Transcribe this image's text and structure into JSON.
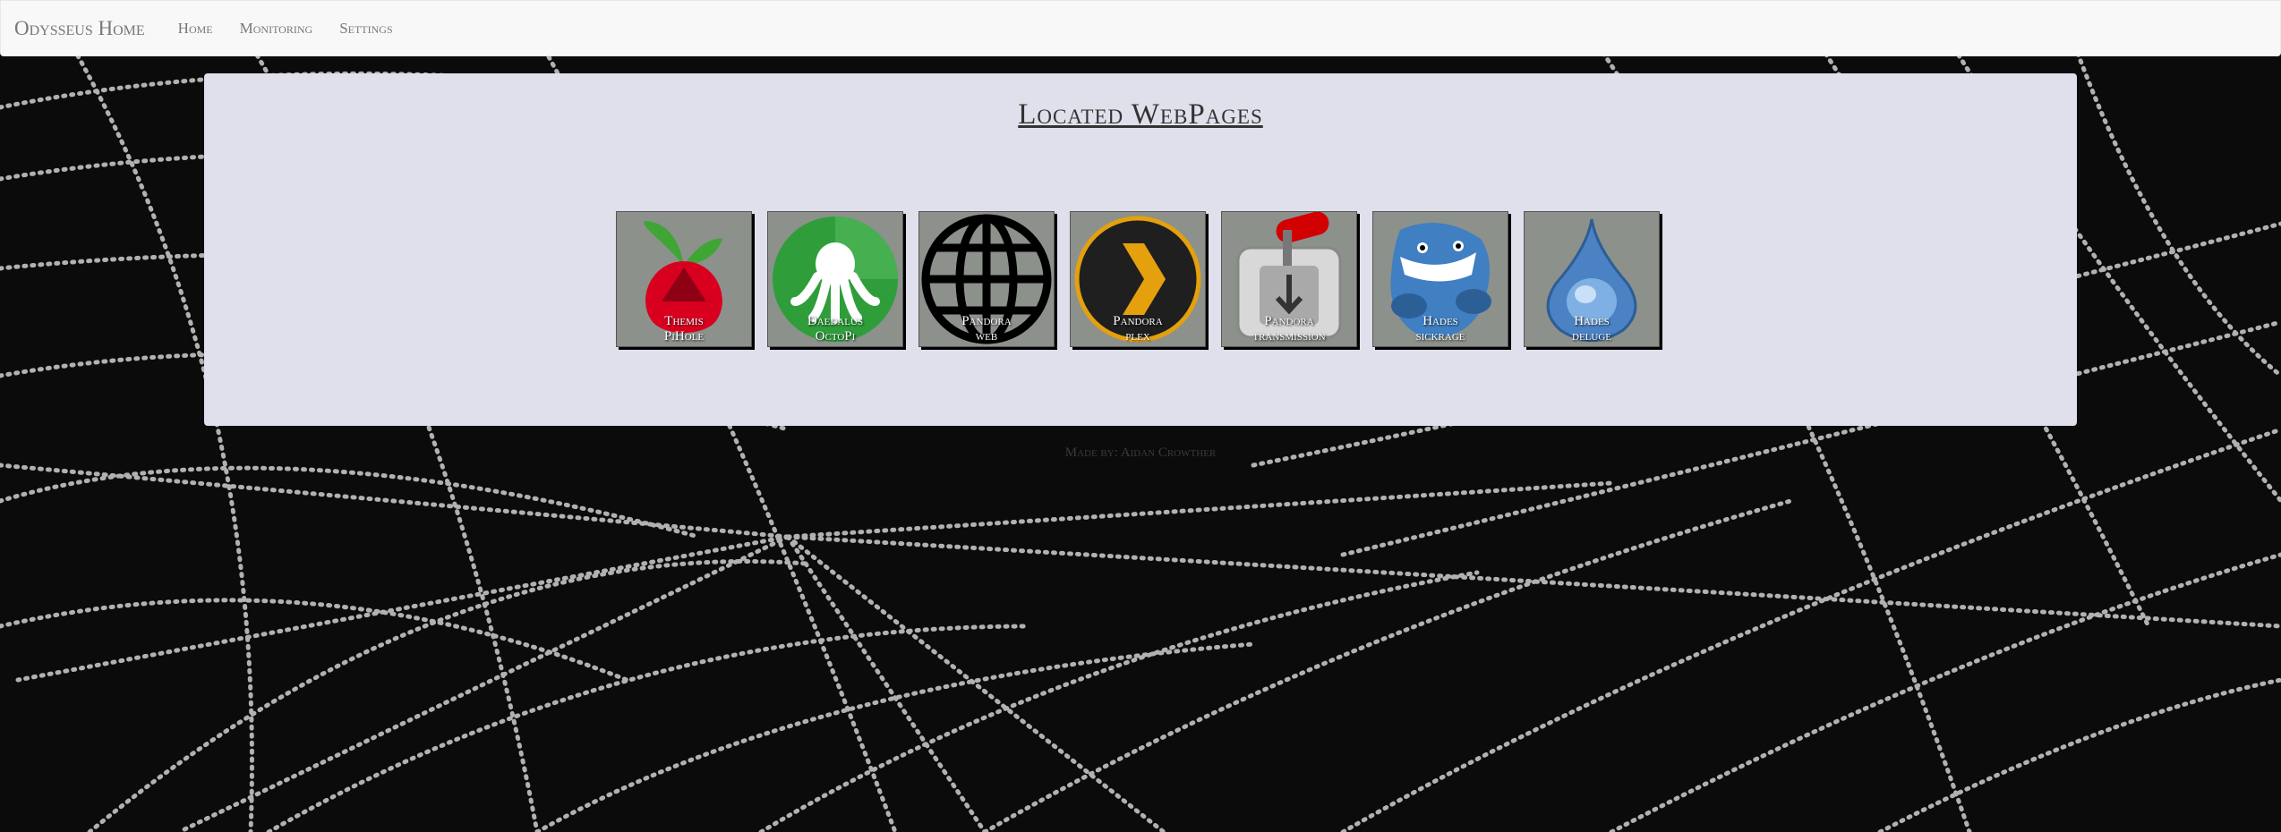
{
  "navbar": {
    "brand": "Odysseus Home",
    "links": [
      "Home",
      "Monitoring",
      "Settings"
    ]
  },
  "main": {
    "title": "Located WebPages",
    "tiles": [
      {
        "line1": "Themis",
        "line2": "PiHole",
        "icon": "pihole-icon"
      },
      {
        "line1": "Daedalus",
        "line2": "OctoPi",
        "icon": "octopi-icon"
      },
      {
        "line1": "Pandora",
        "line2": "web",
        "icon": "globe-icon"
      },
      {
        "line1": "Pandora",
        "line2": "plex",
        "icon": "plex-icon"
      },
      {
        "line1": "Pandora",
        "line2": "transmission",
        "icon": "transmission-icon"
      },
      {
        "line1": "Hades",
        "line2": "sickrage",
        "icon": "sickrage-icon"
      },
      {
        "line1": "Hades",
        "line2": "deluge",
        "icon": "deluge-icon"
      }
    ]
  },
  "footer": {
    "text": "Made by: Aidan Crowther"
  },
  "colors": {
    "navbar_bg": "#f8f8f8",
    "panel_bg": "#dfe0eb",
    "tile_bg": "#8c918c"
  }
}
